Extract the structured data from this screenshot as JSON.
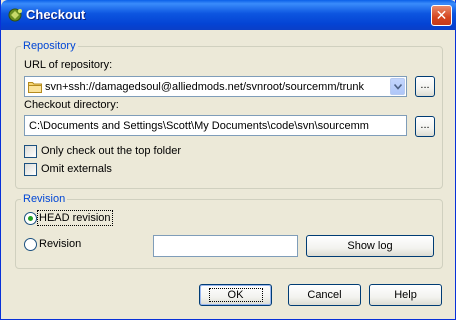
{
  "window": {
    "title": "Checkout",
    "icon": "tortoisesvn-icon",
    "close_icon": "close-icon"
  },
  "repository": {
    "group_label": "Repository",
    "url_label": "URL of repository:",
    "url_value": "svn+ssh://damagedsoul@alliedmods.net/svnroot/sourcemm/trunk",
    "url_browse_label": "...",
    "dir_label": "Checkout directory:",
    "dir_value": "C:\\Documents and Settings\\Scott\\My Documents\\code\\svn\\sourcemm",
    "dir_browse_label": "...",
    "only_top_folder_label": "Only check out the top folder",
    "only_top_folder_checked": false,
    "omit_externals_label": "Omit externals",
    "omit_externals_checked": false
  },
  "revision": {
    "group_label": "Revision",
    "head_label": "HEAD revision",
    "head_selected": true,
    "revision_label": "Revision",
    "revision_selected": false,
    "revision_value": "",
    "show_log_label": "Show log"
  },
  "buttons": {
    "ok_label": "OK",
    "cancel_label": "Cancel",
    "help_label": "Help"
  },
  "colors": {
    "titlebar": "#0a5fe8",
    "group_label": "#0046d5",
    "dialog_bg": "#ece9d8",
    "close_button": "#d5451e"
  }
}
